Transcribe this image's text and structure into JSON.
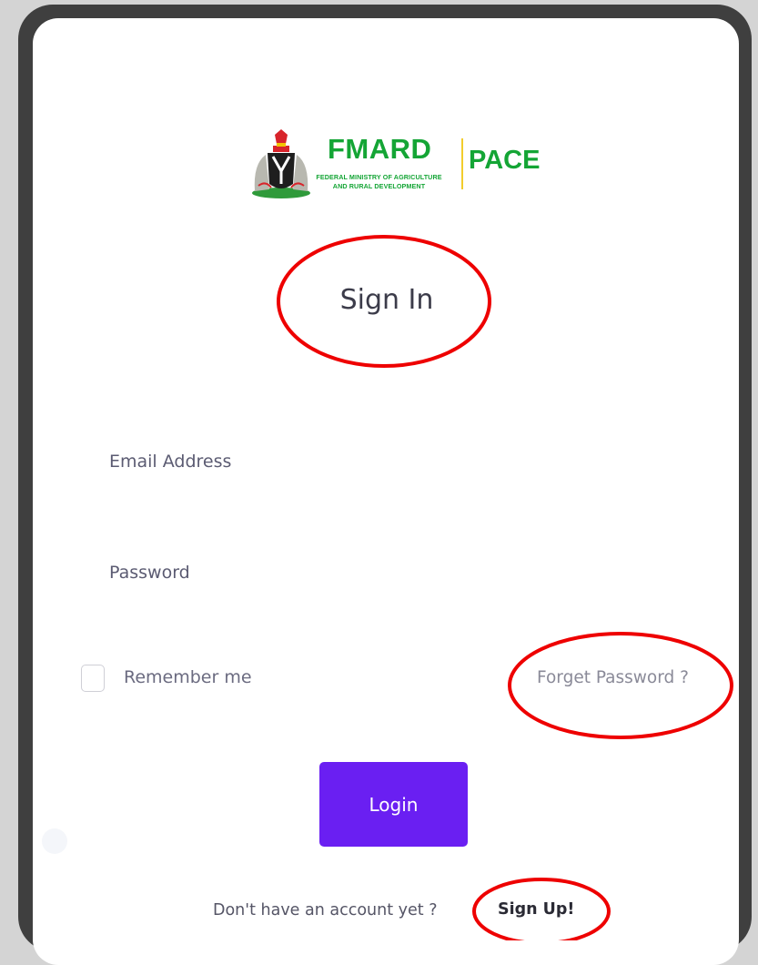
{
  "logo": {
    "brand_word": "FMARD",
    "brand_sub_1": "FEDERAL MINISTRY OF AGRICULTURE",
    "brand_sub_2": "AND RURAL DEVELOPMENT",
    "product": "PACE"
  },
  "form": {
    "title": "Sign In",
    "email_label": "Email Address",
    "password_label": "Password",
    "remember_label": "Remember me",
    "remember_checked": false,
    "forgot_label": "Forget Password ?",
    "login_label": "Login"
  },
  "footer": {
    "prompt": "Don't have an account yet ?",
    "signup_label": "Sign Up!"
  },
  "colors": {
    "accent": "#6a1ff2",
    "brand_green": "#14a535",
    "annotation_red": "#ee0000"
  },
  "icons": [
    "coat-of-arms-icon",
    "checkbox-icon"
  ]
}
